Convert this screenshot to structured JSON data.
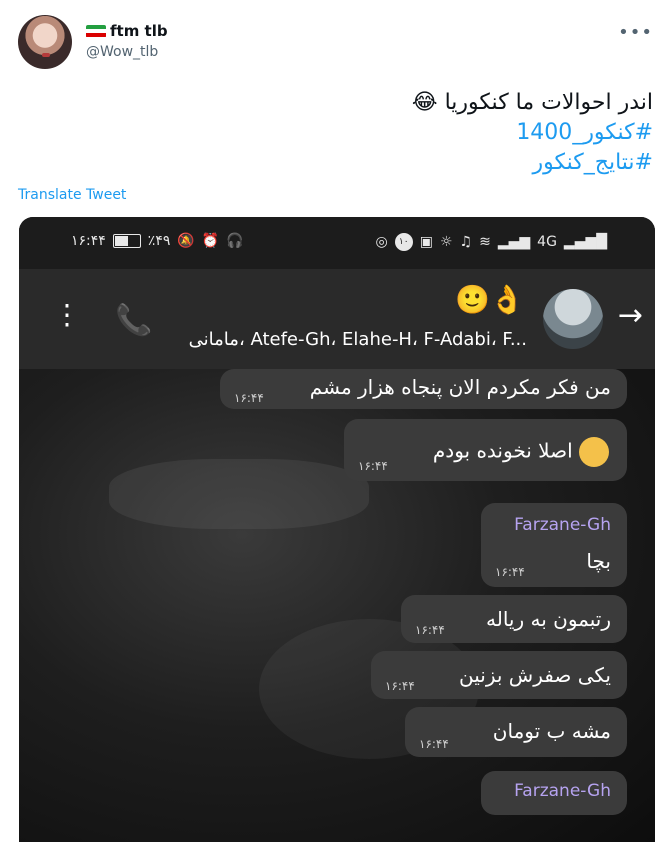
{
  "tweet": {
    "display_name": "ftm tlb",
    "handle": "@Wow_tlb",
    "more_icon": "more-dots-icon",
    "text_line1": "اندر احوالات ما کنکوریا",
    "emoji": "😂",
    "hashtag1": "#کنکور_1400",
    "hashtag2": "#نتایج_کنکور",
    "translate_label": "Translate Tweet"
  },
  "phone": {
    "status_left": "۱۶:۴۴",
    "battery": "٪۴۹",
    "status_badge": "۱۰",
    "network": "4G",
    "chat_title": "مامانی، Atefe-Gh، Elahe-H، F-Adabi، F...",
    "chat_emoji": "🙂👌"
  },
  "messages": [
    {
      "text": "من فکر مکردم الان پنجاه هزار مشم",
      "time": "۱۶:۴۴"
    },
    {
      "text": "اصلا نخونده بودم",
      "time": "۱۶:۴۴"
    },
    {
      "sender": "Farzane-Gh",
      "text": "بچا",
      "time": "۱۶:۴۴"
    },
    {
      "text": "رتبمون به ریاله",
      "time": "۱۶:۴۴"
    },
    {
      "text": "یکی صفرش بزنین",
      "time": "۱۶:۴۴"
    },
    {
      "text": "مشه ب تومان",
      "time": "۱۶:۴۴"
    },
    {
      "sender": "Farzane-Gh"
    }
  ],
  "colors": {
    "link": "#1d9bf0",
    "sender": "#b6a3f0",
    "bubble": "#3b3b3b"
  }
}
